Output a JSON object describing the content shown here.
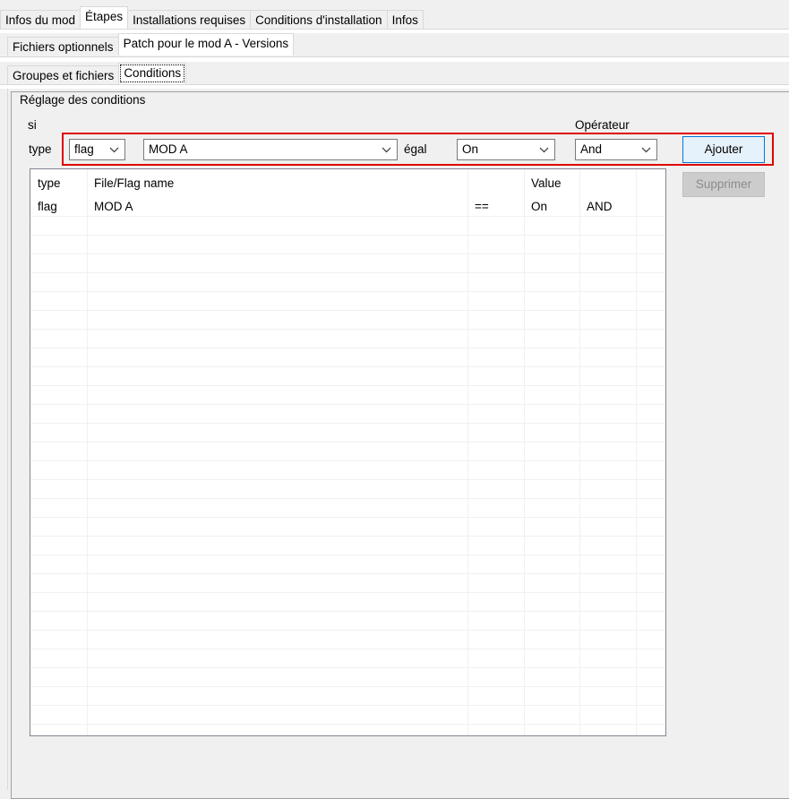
{
  "tabs_level1": [
    "Infos du mod",
    "Étapes",
    "Installations requises",
    "Conditions d'installation",
    "Infos"
  ],
  "tabs_level2": [
    "Fichiers optionnels",
    "Patch pour le mod A - Versions"
  ],
  "tabs_level3": [
    "Groupes et fichiers",
    "Conditions"
  ],
  "group_title": "Réglage des conditions",
  "form": {
    "si_label": "si",
    "type_label": "type",
    "type_value": "flag",
    "name_value": "MOD A",
    "equal_label": "égal",
    "value_value": "On",
    "operator_label": "Opérateur",
    "operator_value": "And"
  },
  "buttons": {
    "add": "Ajouter",
    "remove": "Supprimer"
  },
  "list": {
    "headers": [
      "type",
      "File/Flag name",
      "",
      "Value",
      ""
    ],
    "rows": [
      [
        "flag",
        "MOD A",
        "==",
        "On",
        "AND"
      ]
    ]
  },
  "colors": {
    "highlight": "#e00000",
    "accent": "#0078d7"
  }
}
